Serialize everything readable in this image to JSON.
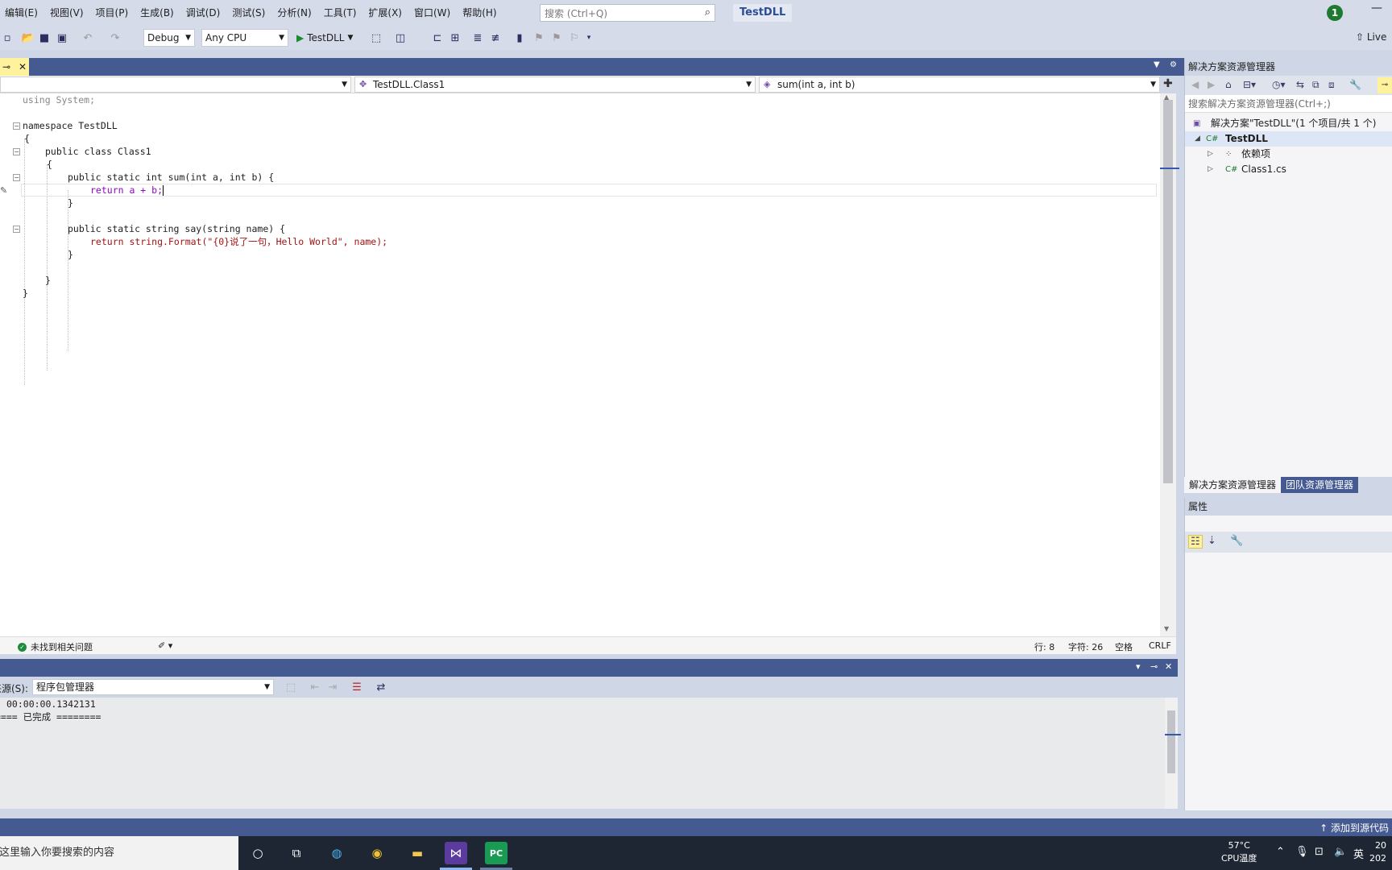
{
  "menu": {
    "items": [
      "编辑(E)",
      "视图(V)",
      "项目(P)",
      "生成(B)",
      "调试(D)",
      "测试(S)",
      "分析(N)",
      "工具(T)",
      "扩展(X)",
      "窗口(W)",
      "帮助(H)"
    ],
    "search_placeholder": "搜索 (Ctrl+Q)",
    "window_title": "TestDLL",
    "notification_count": "1"
  },
  "toolbar": {
    "configuration": "Debug",
    "platform": "Any CPU",
    "start_target": "TestDLL",
    "live_share": "Live"
  },
  "navbar": {
    "type": "TestDLL.Class1",
    "member": "sum(int a, int b)"
  },
  "code": {
    "lines": [
      {
        "text": "using System;"
      },
      {
        "text": ""
      },
      {
        "text": "namespace TestDLL"
      },
      {
        "text": "{"
      },
      {
        "text": "public class Class1"
      },
      {
        "text": "{"
      },
      {
        "text": "public static int sum(int a, int b) {"
      },
      {
        "text": "return a + b;"
      },
      {
        "text": "}"
      },
      {
        "text": ""
      },
      {
        "text": "public static string say(string name) {"
      },
      {
        "text": "return string.Format(\"{0}说了一句，Hello World\", name);"
      },
      {
        "text": "}"
      },
      {
        "text": ""
      },
      {
        "text": "}"
      },
      {
        "text": "}"
      }
    ]
  },
  "editor_status": {
    "issues": "未找到相关问题",
    "line": "行: 8",
    "col": "字符: 26",
    "whitespace": "空格",
    "line_ending": "CRLF"
  },
  "output": {
    "source_label": "来源(S):",
    "source_value": "程序包管理器",
    "lines": [
      "00:00:00.1342131",
      "==== 已完成 ========"
    ]
  },
  "solution_explorer": {
    "title": "解决方案资源管理器",
    "search_placeholder": "搜索解决方案资源管理器(Ctrl+;)",
    "solution": "解决方案\"TestDLL\"(1 个项目/共 1 个)",
    "project": "TestDLL",
    "dependencies": "依赖项",
    "file": "Class1.cs",
    "tab_active": "解决方案资源管理器",
    "tab_inactive": "团队资源管理器"
  },
  "properties": {
    "title": "属性"
  },
  "statusbar": {
    "source_control": "添加到源代码"
  },
  "taskbar": {
    "search_placeholder": "在这里输入你要搜索的内容",
    "temperature": "57°C",
    "temperature_label": "CPU温度",
    "ime": "英",
    "time": "20",
    "date": "202"
  }
}
